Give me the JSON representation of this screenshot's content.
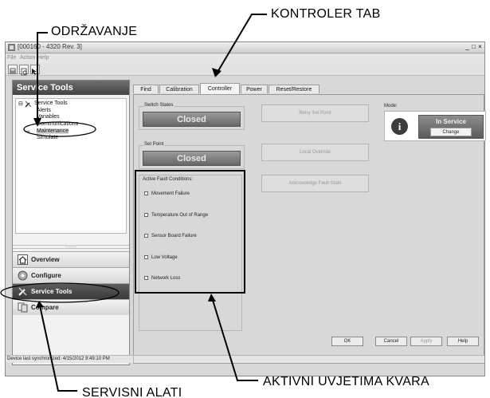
{
  "annotations": {
    "odrzavanje": "ODRŽAVANJE",
    "kontroler_tab": "KONTROLER TAB",
    "aktivni_uvjetima_kvara": "AKTIVNI UVJETIMA KVARA",
    "servisni_alati": "SERVISNI ALATI"
  },
  "window": {
    "title": "[000160 - 4320 Rev. 3]",
    "menu": [
      "File",
      "Action",
      "Help"
    ],
    "controls": [
      "_",
      "□",
      "×"
    ]
  },
  "sidebar": {
    "header": "Service Tools",
    "tree": [
      "Service Tools",
      "Alerts",
      "Variables",
      "Communications",
      "Maintenance",
      "Simulate"
    ],
    "selected": "Maintenance",
    "grip": ".........",
    "nav": [
      "Overview",
      "Configure",
      "Service Tools",
      "Compare"
    ],
    "active_nav": "Service Tools"
  },
  "tabs": [
    "Find",
    "Calibration",
    "Controller",
    "Power",
    "Reset/Restore"
  ],
  "active_tab": "Controller",
  "panel": {
    "switch_states_label": "Switch States",
    "switch_state": "Closed",
    "set_point_label": "Set Point",
    "set_point_state": "Closed",
    "retry_set_point": "Retry Set Point",
    "local_override": "Local Override",
    "acknowledge_fault_state": "Acknowledge Fault State",
    "mode_label": "Mode:",
    "mode_value": "In Service",
    "change_label": "Change",
    "fault_title": "Active Fault Conditions:",
    "faults": [
      {
        "label": "Movement Failure",
        "checked": false
      },
      {
        "label": "Temperature Out of Range",
        "checked": false
      },
      {
        "label": "Sensor Board Failure",
        "checked": false
      },
      {
        "label": "Low Voltage",
        "checked": false
      },
      {
        "label": "Network Loss",
        "checked": false
      }
    ]
  },
  "buttons": {
    "ok": "OK",
    "cancel": "Cancel",
    "apply": "Apply",
    "help": "Help"
  },
  "status": "Device last synchronized: 4/15/2012 9:49:10 PM"
}
